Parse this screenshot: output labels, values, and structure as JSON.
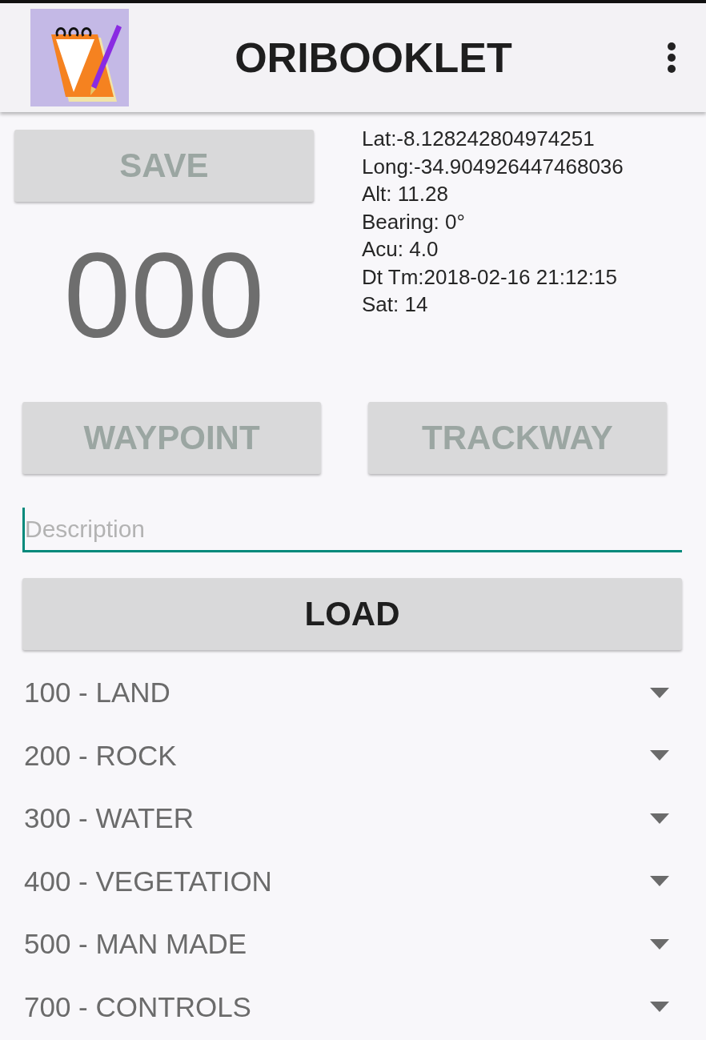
{
  "app_bar": {
    "title": "ORIBOOKLET"
  },
  "save_button": {
    "label": "SAVE",
    "disabled": true
  },
  "counter": "000",
  "gps_info": [
    "Lat:-8.128242804974251",
    "Long:-34.904926447468036",
    "Alt: 11.28",
    "Bearing: 0°",
    "Acu: 4.0",
    "Dt Tm:2018-02-16 21:12:15",
    "Sat: 14"
  ],
  "mode_buttons": [
    {
      "label": "WAYPOINT",
      "disabled": true
    },
    {
      "label": "TRACKWAY",
      "disabled": true
    }
  ],
  "description": {
    "placeholder": "Description",
    "focused": true
  },
  "load_button": {
    "label": "LOAD",
    "disabled": false
  },
  "spinners": [
    {
      "label": "100 - LAND"
    },
    {
      "label": "200 - ROCK"
    },
    {
      "label": "300 - WATER"
    },
    {
      "label": "400 - VEGETATION"
    },
    {
      "label": "500 - MAN MADE"
    },
    {
      "label": "700 - CONTROLS"
    }
  ]
}
